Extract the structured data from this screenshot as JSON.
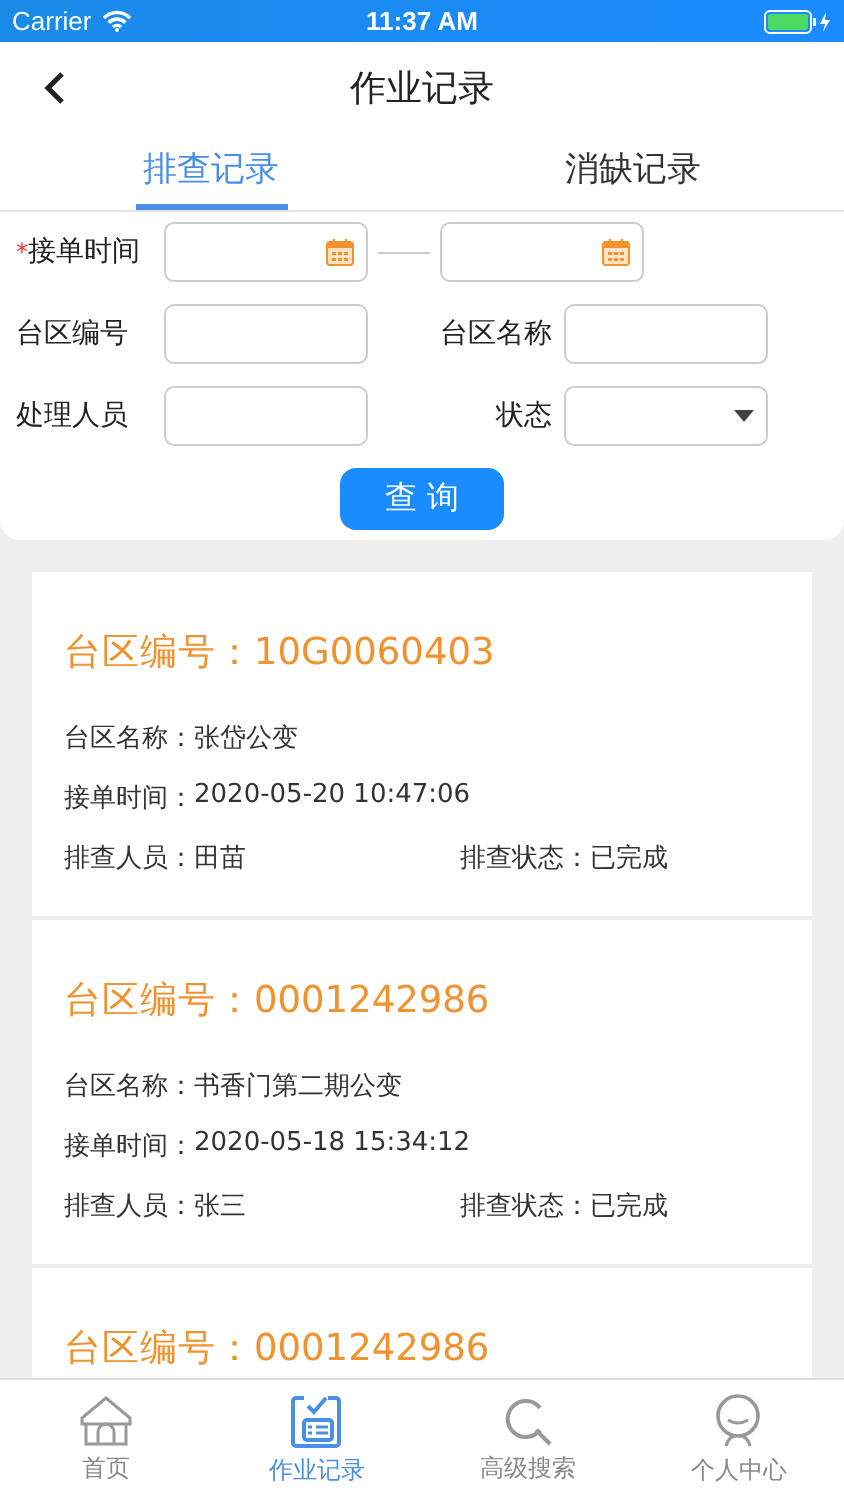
{
  "status_bar": {
    "carrier": "Carrier",
    "time": "11:37 AM"
  },
  "header": {
    "title": "作业记录"
  },
  "tabs": [
    {
      "label": "排查记录",
      "selected": true
    },
    {
      "label": "消缺记录",
      "selected": false
    }
  ],
  "filters": [
    {
      "label": "接单时间",
      "required_mark": "*",
      "kind": "date_range"
    },
    {
      "label": "台区编号",
      "kind": "text"
    },
    {
      "label": "台区名称",
      "kind": "text"
    },
    {
      "label": "处理人员",
      "kind": "text"
    },
    {
      "label": "状态",
      "kind": "select"
    }
  ],
  "search_button": "查 询",
  "records": [
    {
      "title": "台区编号：10G0060403",
      "rows": [
        [
          {
            "label": "台区名称：",
            "value": "张岱公变"
          }
        ],
        [
          {
            "label": "接单时间：",
            "value": "2020-05-20 10:47:06"
          }
        ],
        [
          {
            "label": "排查人员：",
            "value": "田苗"
          },
          {
            "label": "排查状态：",
            "value": "已完成"
          }
        ]
      ]
    },
    {
      "title": "台区编号：0001242986",
      "rows": [
        [
          {
            "label": "台区名称：",
            "value": "书香门第二期公变"
          }
        ],
        [
          {
            "label": "接单时间：",
            "value": "2020-05-18 15:34:12"
          }
        ],
        [
          {
            "label": "排查人员：",
            "value": "张三"
          },
          {
            "label": "排查状态：",
            "value": "已完成"
          }
        ]
      ]
    },
    {
      "title": "台区编号：0001242986"
    }
  ],
  "bottom_nav": [
    {
      "label": "首页",
      "kind": "home",
      "selected": false
    },
    {
      "label": "作业记录",
      "kind": "records",
      "selected": true
    },
    {
      "label": "高级搜索",
      "kind": "search",
      "selected": false
    },
    {
      "label": "个人中心",
      "kind": "person",
      "selected": false
    }
  ]
}
